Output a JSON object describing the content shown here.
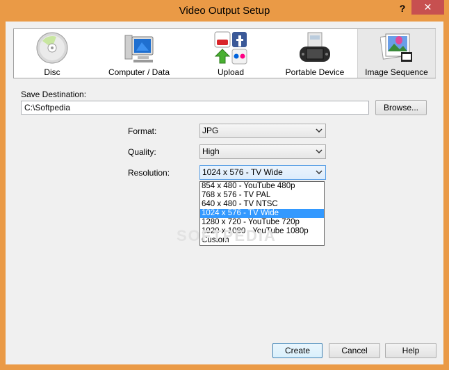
{
  "window": {
    "title": "Video Output Setup",
    "help_glyph": "?",
    "close_glyph": "✕"
  },
  "toolbar": {
    "items": [
      {
        "label": "Disc",
        "icon": "disc-icon"
      },
      {
        "label": "Computer / Data",
        "icon": "computer-icon"
      },
      {
        "label": "Upload",
        "icon": "upload-icon"
      },
      {
        "label": "Portable Device",
        "icon": "portable-device-icon"
      },
      {
        "label": "Image Sequence",
        "icon": "image-sequence-icon"
      }
    ],
    "selected": "Image Sequence"
  },
  "destination": {
    "label": "Save Destination:",
    "value": "C:\\Softpedia",
    "browse_label": "Browse..."
  },
  "form": {
    "format_label": "Format:",
    "format_value": "JPG",
    "quality_label": "Quality:",
    "quality_value": "High",
    "resolution_label": "Resolution:",
    "resolution_value": "1024 x 576 - TV Wide"
  },
  "resolution_options": [
    "854 x 480 - YouTube 480p",
    "768 x 576 - TV PAL",
    "640 x 480 - TV NTSC",
    "1024 x 576 - TV Wide",
    "1280 x 720 - YouTube 720p",
    "1920 x 1080 - YouTube 1080p",
    "Custom"
  ],
  "watermark": "SOFTPEDIA",
  "buttons": {
    "create": "Create",
    "cancel": "Cancel",
    "help": "Help"
  },
  "colors": {
    "title_bar": "#ea9a46",
    "close_button": "#c75050",
    "selection": "#3399ff"
  }
}
